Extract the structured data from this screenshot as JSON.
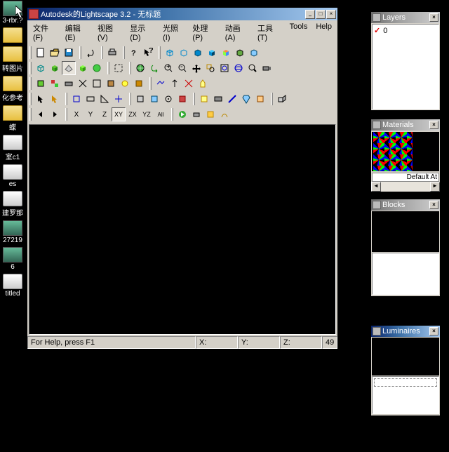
{
  "app": {
    "title": "Autodesk的Lightscape 3.2  - 无标题",
    "menus": [
      "文件(F)",
      "编辑(E)",
      "视图(V)",
      "显示(D)",
      "光照(I)",
      "处理(P)",
      "动画(A)",
      "工具(T)",
      "Tools",
      "Help"
    ],
    "status": {
      "help": "For Help, press F1",
      "x": "X:",
      "y": "Y:",
      "z": "Z:",
      "num": "49"
    }
  },
  "panels": {
    "layers": {
      "title": "Layers",
      "items": [
        {
          "label": "0"
        }
      ]
    },
    "materials": {
      "title": "Materials",
      "default": "Default At"
    },
    "blocks": {
      "title": "Blocks"
    },
    "luminaires": {
      "title": "Luminaires"
    }
  },
  "desktop": [
    "3-rbr.?",
    "",
    "转图片",
    "化参考",
    "蝶",
    "室c1",
    "es",
    "建罗那",
    "27219",
    "6",
    "titled"
  ]
}
